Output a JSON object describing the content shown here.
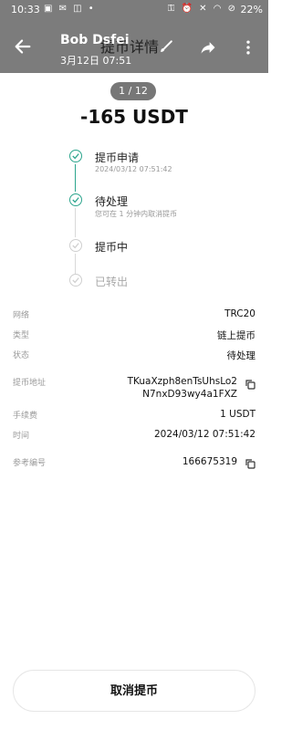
{
  "statusbar": {
    "time": "10:33",
    "left_icons": "▣ ✉ ◫ •",
    "right_icons": "⚿ ⏰ ✕ ◠ ⊘",
    "battery": "22%"
  },
  "header": {
    "sender": "Bob Dsfei",
    "sent_time": "3月12日 07:51",
    "title": "提币详情",
    "icons": [
      "back-arrow-icon",
      "brush-icon",
      "share-icon",
      "more-vertical-icon"
    ]
  },
  "counter": "1 / 12",
  "amount": "-165 USDT",
  "timeline": [
    {
      "label": "提币申请",
      "sub": "2024/03/12 07:51:42",
      "status": "done"
    },
    {
      "label": "待处理",
      "sub": "您可在 1 分钟内取消提币",
      "status": "done"
    },
    {
      "label": "提币中",
      "sub": "",
      "status": "pending"
    },
    {
      "label": "已转出",
      "sub": "",
      "status": "pending"
    }
  ],
  "details": {
    "network_key": "网络",
    "network_val": "TRC20",
    "type_key": "类型",
    "type_val": "链上提币",
    "status_key": "状态",
    "status_val": "待处理",
    "address_key": "提币地址",
    "address_line1": "TKuaXzph8enTsUhsLo2",
    "address_line2": "N7nxD93wy4a1FXZ",
    "fee_key": "手续费",
    "fee_val": "1 USDT",
    "time_key": "时间",
    "time_val": "2024/03/12 07:51:42",
    "ref_key": "参考编号",
    "ref_val": "166675319"
  },
  "colors": {
    "accent": "#2ca58d",
    "overlay": "#7c7c7c"
  },
  "cancel_label": "取消提币"
}
